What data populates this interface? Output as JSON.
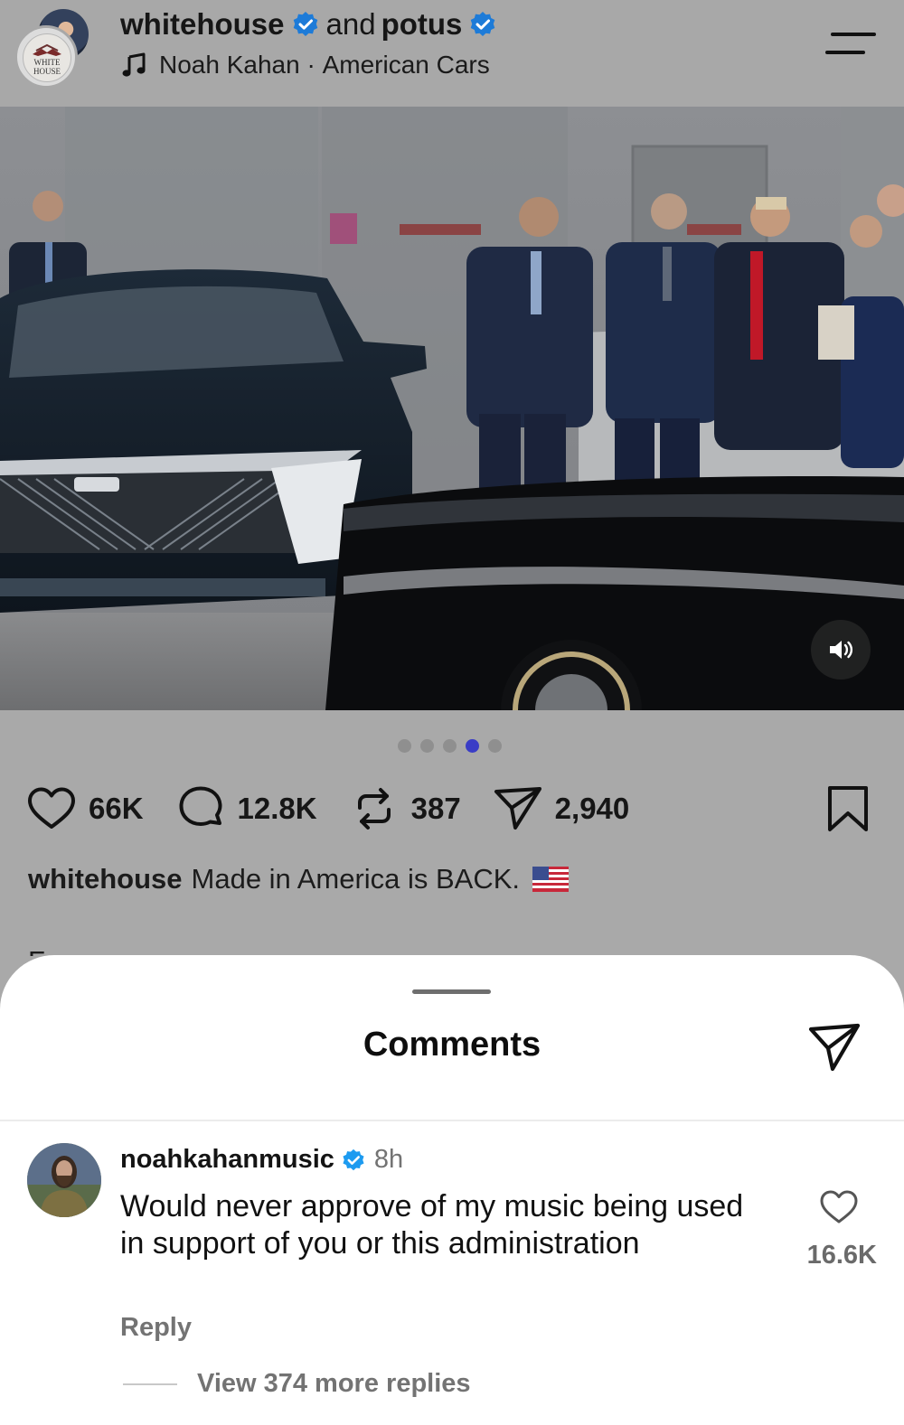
{
  "header": {
    "account_primary": "whitehouse",
    "joiner": "and",
    "account_secondary": "potus",
    "audio_artist": "Noah Kahan",
    "audio_separator": " · ",
    "audio_title": "American Cars",
    "seal_text_top": "WHITE",
    "seal_text_bottom": "HOUSE"
  },
  "media": {
    "carousel_total": 5,
    "carousel_active_index": 3,
    "sound_icon": "speaker-on-icon"
  },
  "actions": {
    "likes": "66K",
    "comments": "12.8K",
    "reposts": "387",
    "shares": "2,940"
  },
  "caption": {
    "user": "whitehouse",
    "text": "Made in America is BACK.",
    "emoji": "us-flag-icon",
    "truncated_next_line": "F . . . . . . . . . . . . . . . . ."
  },
  "comments_sheet": {
    "title": "Comments",
    "comment": {
      "user": "noahkahanmusic",
      "time": "8h",
      "text": "Would never approve of my music being used in support of you or this administration",
      "reply_label": "Reply",
      "like_count": "16.6K",
      "view_replies": "View 374 more replies"
    }
  },
  "colors": {
    "verified": "#1d9bf0",
    "carousel_active": "#3a3dc6",
    "dim_overlay": "#a9a9a9"
  }
}
